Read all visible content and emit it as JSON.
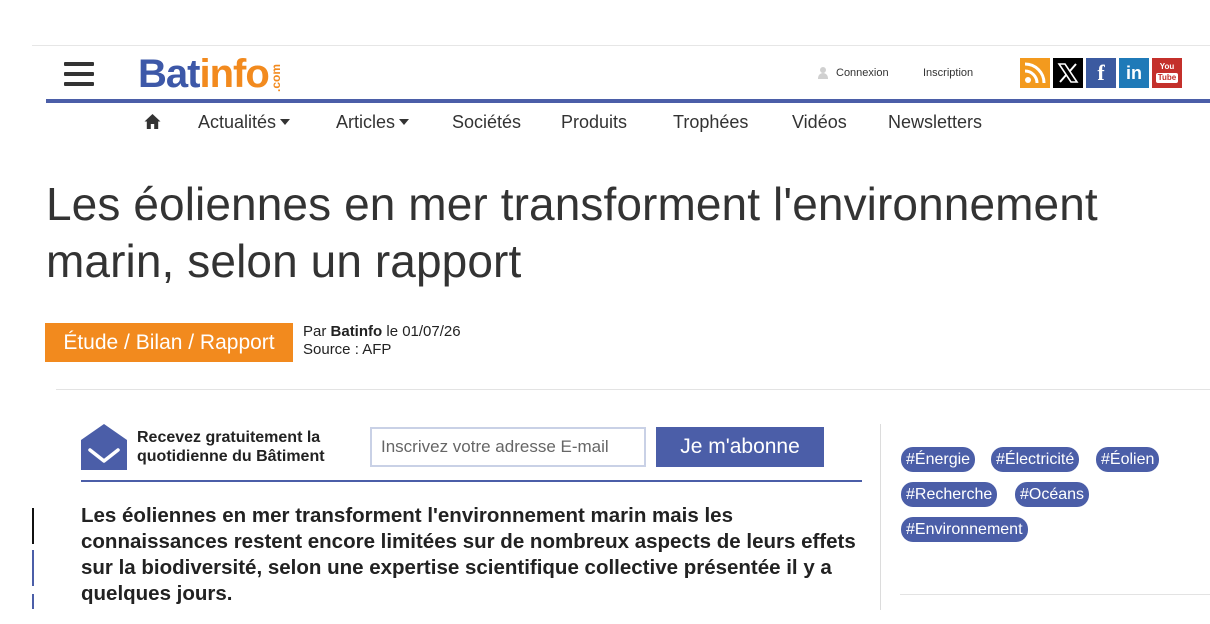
{
  "header": {
    "logo": {
      "part1": "Bat",
      "part2": "info",
      "suffix": ".com"
    },
    "connexion": "Connexion",
    "inscription": "Inscription",
    "social_icons": [
      "rss-icon",
      "x-icon",
      "facebook-icon",
      "linkedin-icon",
      "youtube-icon"
    ],
    "social_glyphs": {
      "facebook": "f",
      "linkedin": "in",
      "youtube_top": "You",
      "youtube_bottom": "Tube"
    }
  },
  "nav": {
    "home_icon": "home-icon",
    "items": [
      "Actualités",
      "Articles",
      "Sociétés",
      "Produits",
      "Trophées",
      "Vidéos",
      "Newsletters"
    ]
  },
  "article": {
    "title_line1": "Les éoliennes en mer transforment l'environnement",
    "title_line2": "marin, selon un rapport",
    "category": "Étude / Bilan / Rapport",
    "by_prefix": "Par ",
    "author": "Batinfo",
    "date_prefix": " le ",
    "date": "01/07/26",
    "source": "Source : AFP",
    "lead": "Les éoliennes en mer transforment l'environnement marin mais les connaissances restent encore limitées sur de nombreux aspects de leurs effets sur la biodiversité, selon une expertise scientifique collective présentée il y a quelques jours."
  },
  "newsletter": {
    "line1": "Recevez gratuitement la",
    "line2": "quotidienne du Bâtiment",
    "placeholder": "Inscrivez votre adresse E-mail",
    "button": "Je m'abonne"
  },
  "tags": [
    "#Énergie",
    "#Électricité",
    "#Éolien",
    "#Recherche",
    "#Océans",
    "#Environnement"
  ],
  "colors": {
    "brand_blue": "#4b5ea8",
    "brand_orange": "#f28a1e"
  }
}
